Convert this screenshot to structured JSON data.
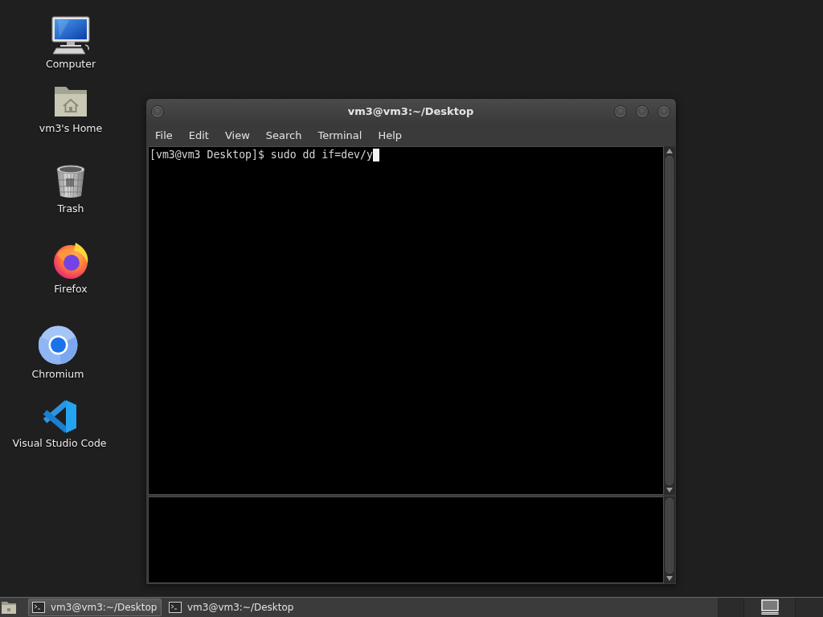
{
  "desktop_icons": [
    {
      "kind": "computer",
      "label": "Computer"
    },
    {
      "kind": "home",
      "label": "vm3's Home"
    },
    {
      "kind": "trash",
      "label": "Trash"
    },
    {
      "kind": "firefox",
      "label": "Firefox"
    },
    {
      "kind": "chromium",
      "label": "Chromium"
    },
    {
      "kind": "vscode",
      "label": "Visual Studio Code"
    }
  ],
  "window": {
    "title": "vm3@vm3:~/Desktop",
    "menu": [
      "File",
      "Edit",
      "View",
      "Search",
      "Terminal",
      "Help"
    ],
    "terminal_line": "[vm3@vm3 Desktop]$ sudo dd if=dev/y"
  },
  "taskbar": {
    "tasks": [
      {
        "label": "vm3@vm3:~/Desktop",
        "selected": true
      },
      {
        "label": "vm3@vm3:~/Desktop",
        "selected": false
      }
    ]
  }
}
